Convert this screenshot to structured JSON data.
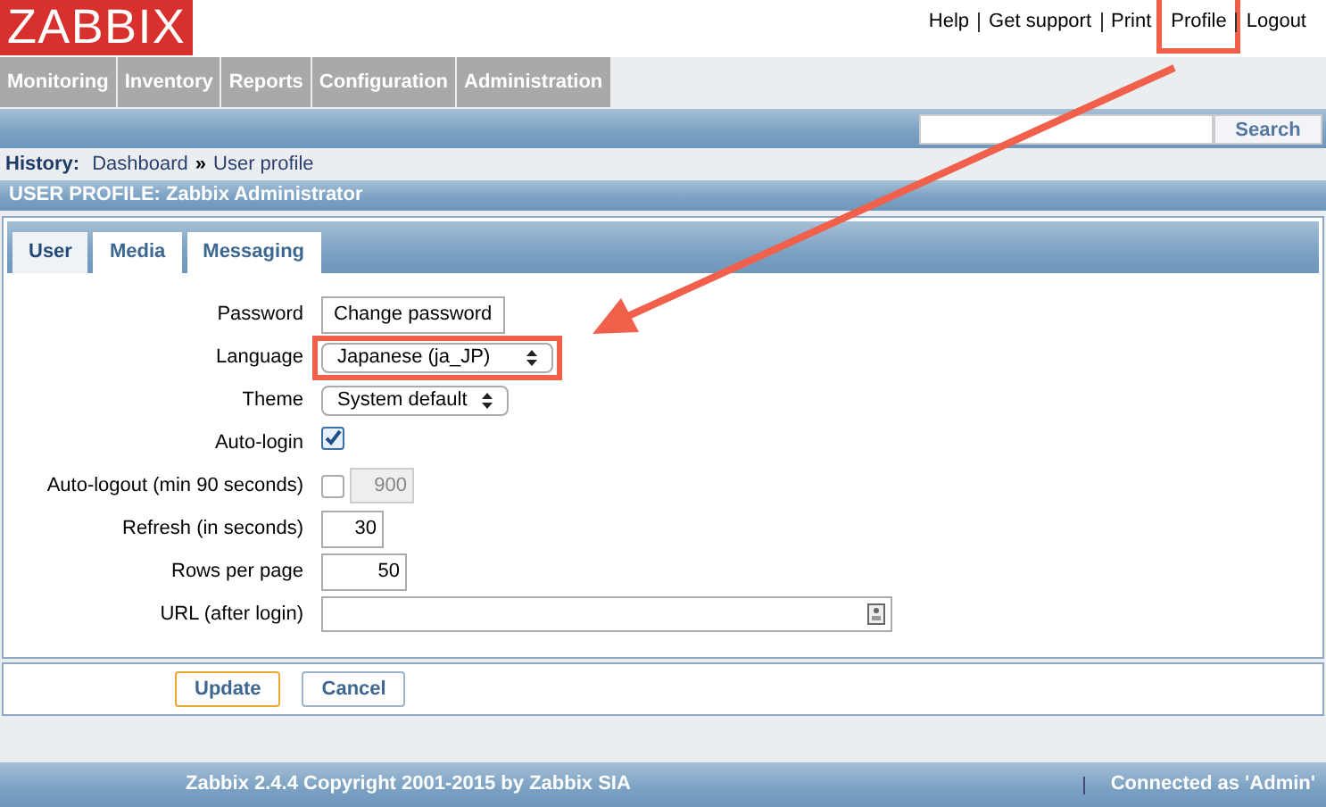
{
  "logo": "ZABBIX",
  "header_links": [
    {
      "label": "Help",
      "highlighted": false
    },
    {
      "label": "Get support",
      "highlighted": false
    },
    {
      "label": "Print",
      "highlighted": false
    },
    {
      "label": "Profile",
      "highlighted": true
    },
    {
      "label": "Logout",
      "highlighted": false
    }
  ],
  "menu": [
    {
      "label": "Monitoring",
      "selected": false
    },
    {
      "label": "Inventory",
      "selected": false
    },
    {
      "label": "Reports",
      "selected": false
    },
    {
      "label": "Configuration",
      "selected": false
    },
    {
      "label": "Administration",
      "selected": false
    }
  ],
  "search": {
    "button": "Search"
  },
  "history": {
    "label": "History:",
    "items": [
      "Dashboard",
      "User profile"
    ],
    "separator": "»"
  },
  "page_title": "USER PROFILE: Zabbix Administrator",
  "tabs": [
    {
      "label": "User",
      "selected": true
    },
    {
      "label": "Media",
      "selected": false
    },
    {
      "label": "Messaging",
      "selected": false
    }
  ],
  "fields": [
    {
      "label": "Password",
      "kind": "button",
      "value": "Change password",
      "highlighted": false
    },
    {
      "label": "Language",
      "kind": "select",
      "value": "Japanese (ja_JP)",
      "highlighted": true
    },
    {
      "label": "Theme",
      "kind": "select",
      "value": "System default",
      "highlighted": false
    },
    {
      "label": "Auto-login",
      "kind": "checkbox",
      "checked": true,
      "highlighted": false
    },
    {
      "label": "Auto-logout (min 90 seconds)",
      "kind": "checkbox_number",
      "checked": false,
      "value": "900",
      "highlighted": false
    },
    {
      "label": "Refresh (in seconds)",
      "kind": "number",
      "value": "30",
      "highlighted": false
    },
    {
      "label": "Rows per page",
      "kind": "number",
      "value": "50",
      "highlighted": false
    },
    {
      "label": "URL (after login)",
      "kind": "text",
      "highlighted": false
    }
  ],
  "buttons": [
    {
      "label": "Update",
      "selected": true
    },
    {
      "label": "Cancel",
      "selected": false
    }
  ],
  "footer": {
    "copyright": "Zabbix 2.4.4 Copyright 2001-2015 by Zabbix SIA",
    "connected": "Connected as 'Admin'"
  }
}
